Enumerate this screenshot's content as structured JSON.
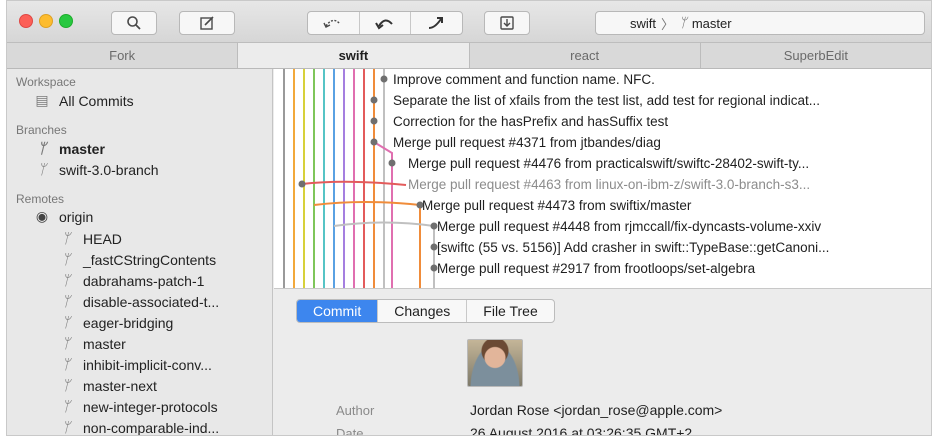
{
  "toolbar": {
    "branch_repo": "swift",
    "branch_sep": "〉",
    "branch_name": "master"
  },
  "tabs": [
    {
      "label": "Fork"
    },
    {
      "label": "swift"
    },
    {
      "label": "react"
    },
    {
      "label": "SuperbEdit"
    }
  ],
  "sidebar": {
    "workspace_heading": "Workspace",
    "all_commits": "All Commits",
    "branches_heading": "Branches",
    "branches": [
      "master",
      "swift-3.0-branch"
    ],
    "remotes_heading": "Remotes",
    "origin": "origin",
    "remote_branches": [
      "HEAD",
      "_fastCStringContents",
      "dabrahams-patch-1",
      "disable-associated-t...",
      "eager-bridging",
      "master",
      "inhibit-implicit-conv...",
      "master-next",
      "new-integer-protocols",
      "non-comparable-ind..."
    ]
  },
  "commits": [
    "Improve comment and function name. NFC.",
    "Separate the list of xfails from the test list, add test for regional indicat...",
    "Correction for the hasPrefix and hasSuffix test",
    "Merge pull request #4371 from jtbandes/diag",
    "Merge pull request #4476 from practicalswift/swiftc-28402-swift-ty...",
    "Merge pull request #4463 from linux-on-ibm-z/swift-3.0-branch-s3...",
    "Merge pull request #4473 from swiftix/master",
    "Merge pull request #4448 from rjmccall/fix-dyncasts-volume-xxiv",
    "[swiftc (55 vs. 5156)] Add crasher in swift::TypeBase::getCanoni...",
    "Merge pull request #2917 from frootloops/set-algebra"
  ],
  "detail": {
    "tabs": [
      "Commit",
      "Changes",
      "File Tree"
    ],
    "author_label": "Author",
    "author_value": "Jordan Rose <jordan_rose@apple.com>",
    "date_label": "Date",
    "date_value": "26 August 2016 at 03:26:35 GMT+2"
  },
  "colors": {
    "accent": "#3d86ee",
    "lanes": [
      "#9a9a9a",
      "#f2a93b",
      "#d7d13a",
      "#7fc65a",
      "#56c4c6",
      "#5aa1e3",
      "#a57fe0",
      "#e06fb0",
      "#e35b5b",
      "#f08c3a",
      "#c0c0c0"
    ]
  },
  "icons": {
    "search": "magnifier-icon",
    "edit": "compose-icon",
    "fetch": "fetch-icon",
    "pull": "pull-icon",
    "push": "push-icon",
    "stash": "stash-icon",
    "branch": "branch-icon",
    "github": "github-icon",
    "monitor": "monitor-icon"
  }
}
